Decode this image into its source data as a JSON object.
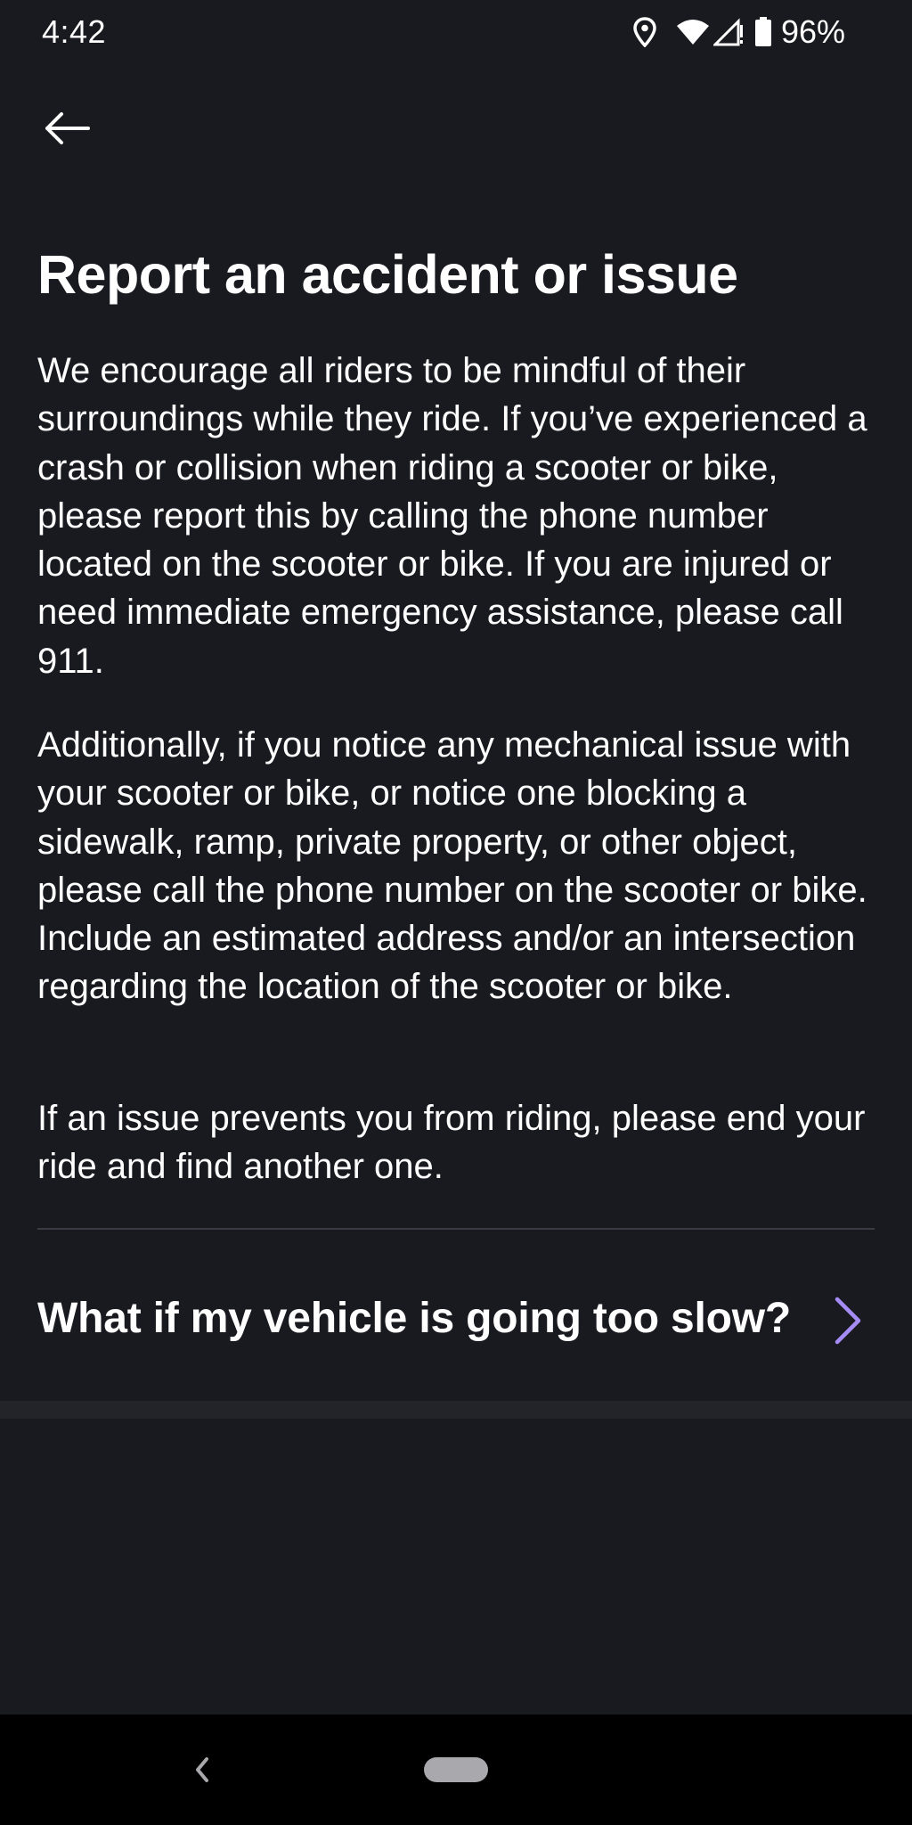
{
  "status_bar": {
    "time": "4:42",
    "battery_percent": "96%",
    "icons": [
      "location-icon",
      "wifi-icon",
      "signal-icon",
      "battery-icon"
    ]
  },
  "header": {
    "back_icon": "arrow-left-icon"
  },
  "page": {
    "title": "Report an accident or issue",
    "paragraphs": [
      "We encourage all riders to be mindful of their surroundings while they ride. If you’ve experienced a crash or collision when riding a scooter or bike, please report this by calling the phone number located on the scooter or bike. If you are injured or need immediate emergency assistance, please call 911.",
      "Additionally, if you notice any mechanical issue with your scooter or bike, or notice one blocking a sidewalk, ramp, private property, or other object, please call the phone number on the scooter or bike. Include an estimated address and/or an intersection regarding the location of the scooter or bike.",
      "If an issue prevents you from riding, please end your ride and find another one."
    ]
  },
  "faq": {
    "question": "What if my vehicle is going too slow?",
    "chevron_color": "#a58cf5"
  },
  "colors": {
    "background": "#191920",
    "text": "#ffffff",
    "accent": "#a58cf5"
  },
  "nav_bar": {
    "back_icon": "chevron-left-icon",
    "home_icon": "home-pill-icon"
  }
}
